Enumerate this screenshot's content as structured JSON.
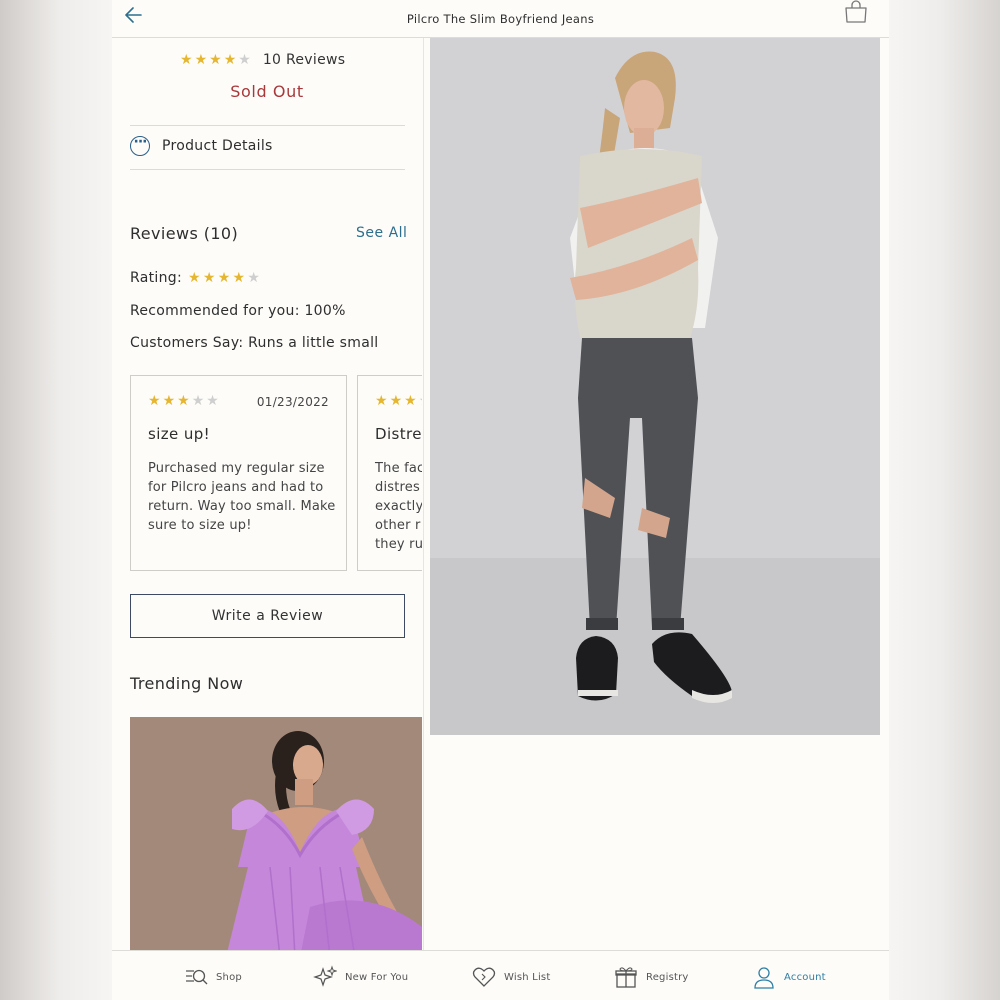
{
  "header": {
    "title": "Pilcro The Slim Boyfriend Jeans",
    "back_icon": "back-arrow-icon",
    "bag_icon": "shopping-bag-icon"
  },
  "product": {
    "rating": 4,
    "rating_max": 5,
    "reviews_count_label": "10 Reviews",
    "status": "Sold Out"
  },
  "details": {
    "label": "Product Details",
    "icon": "more-icon"
  },
  "reviews": {
    "heading": "Reviews (10)",
    "see_all": "See All",
    "rating_label": "Rating:",
    "rating": 4,
    "recommended": "Recommended for you: 100%",
    "customers_say": "Customers Say: Runs a little small",
    "cards": [
      {
        "stars": 3,
        "date": "01/23/2022",
        "title": "size up!",
        "body": "Purchased my regular size for Pilcro jeans and had to return. Way too small. Make sure to size up!"
      },
      {
        "stars": 3,
        "date": "",
        "title": "Distre",
        "body": "The fac distres exactly other r they ru"
      }
    ],
    "write_review": "Write a Review"
  },
  "trending": {
    "heading": "Trending Now"
  },
  "nav": {
    "items": [
      {
        "label": "Shop",
        "icon": "shop-icon"
      },
      {
        "label": "New For You",
        "icon": "sparkle-icon"
      },
      {
        "label": "Wish List",
        "icon": "heart-icon"
      },
      {
        "label": "Registry",
        "icon": "gift-icon"
      },
      {
        "label": "Account",
        "icon": "person-icon",
        "active": true
      }
    ]
  },
  "colors": {
    "star": "#e5b730",
    "sold_out": "#a9383a",
    "link": "#2d6f8f",
    "active_nav": "#2d7fa7"
  }
}
